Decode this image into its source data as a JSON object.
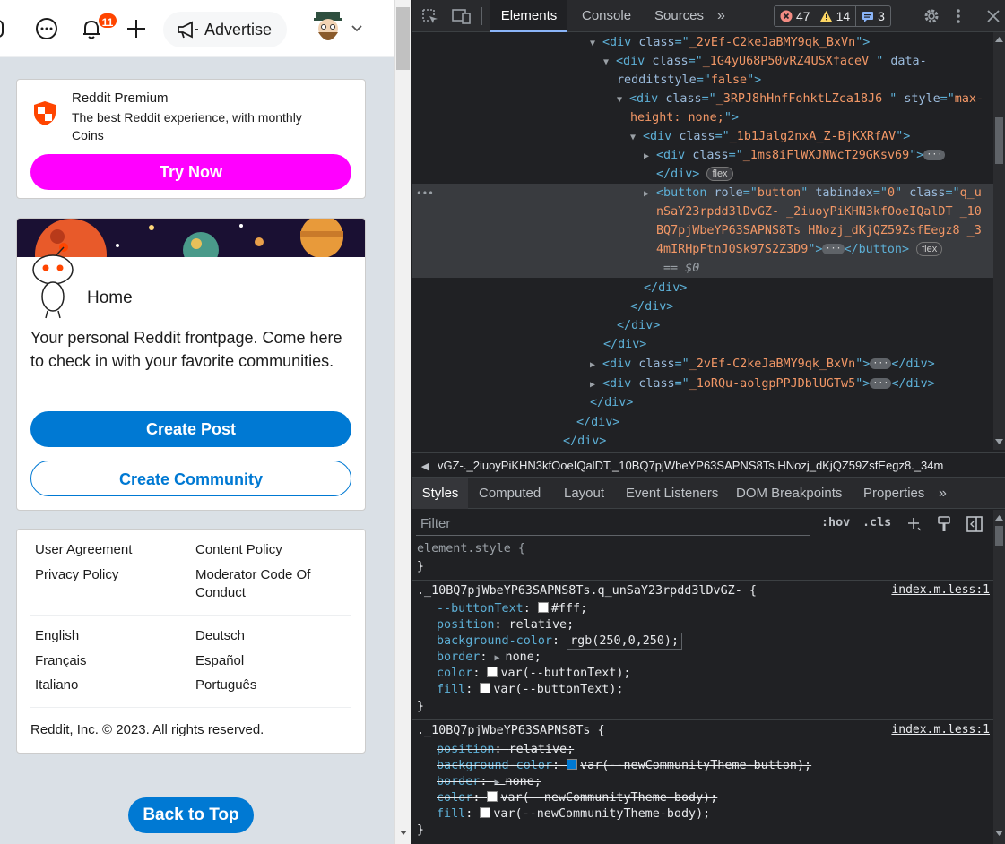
{
  "reddit": {
    "notification_count": "11",
    "advertise_label": "Advertise",
    "premium": {
      "title": "Reddit Premium",
      "desc_line1": "The best Reddit experience, with monthly",
      "desc_line2": "Coins",
      "button": "Try Now"
    },
    "home": {
      "title": "Home",
      "desc_line1": "Your personal Reddit frontpage. Come here",
      "desc_line2": "to check in with your favorite communities.",
      "create_post": "Create Post",
      "create_community": "Create Community"
    },
    "footer": {
      "links": [
        "User Agreement",
        "Content Policy",
        "Privacy Policy",
        "Moderator Code Of",
        "Conduct"
      ],
      "languages": [
        "English",
        "Deutsch",
        "Français",
        "Español",
        "Italiano",
        "Português"
      ],
      "copyright": "Reddit, Inc. © 2023. All rights reserved."
    },
    "back_to_top": "Back to Top"
  },
  "devtools": {
    "tabs": [
      "Elements",
      "Console",
      "Sources"
    ],
    "errors": "47",
    "warnings": "14",
    "messages": "3",
    "dom": {
      "l1": "_2vEf-C2keJaBMY9qk_BxVn",
      "l2a": "_1G4yU68P50vRZ4USXfaceV ",
      "l2b": "data-",
      "l2c": "redditstyle",
      "l2d": "false",
      "l3a": "_3RPJ8hHnfFohktLZca18J6 ",
      "l3b": "max-",
      "l3c": "height: none;",
      "l4": "_1b1Jalg2nxA_Z-BjKXRfAV",
      "l5": "_1ms8iFlWXJNWcT29GKsv69",
      "l7_role": "button",
      "l7_tabindex": "0",
      "l7_class_part": "q_u",
      "l8": "nSaY23rpdd3lDvGZ- _2iuoyPiKHN3kfOoeIQalDT _10",
      "l9": "BQ7pjWbeYP63SAPNS8Ts HNozj_dKjQZ59ZsfEegz8 _3",
      "l10": "4mIRHpFtnJ0Sk97S2Z3D9",
      "eq0": "== $0",
      "l16": "_2vEf-C2keJaBMY9qk_BxVn",
      "l17": "_1oRQu-aolgpPPJDblUGTw5",
      "flex": "flex"
    },
    "breadcrumb": "vGZ-._2iuoyPiKHN3kfOoeIQalDT._10BQ7pjWbeYP63SAPNS8Ts.HNozj_dKjQZ59ZsfEegz8._34m",
    "subtabs": [
      "Styles",
      "Computed",
      "Layout",
      "Event Listeners",
      "DOM Breakpoints",
      "Properties"
    ],
    "filter_placeholder": "Filter",
    "hov": ":hov",
    "cls": ".cls",
    "styles": {
      "element_style": "element.style {",
      "close": "}",
      "rule1_selector": "._10BQ7pjWbeYP63SAPNS8Ts.q_unSaY23rpdd3lDvGZ- {",
      "rule1_source": "index.m.less:1",
      "r1p1": "--buttonText",
      "r1v1": "#fff;",
      "r1p2": "position",
      "r1v2": "relative;",
      "r1p3": "background-color",
      "r1v3": "rgb(250,0,250);",
      "r1p4": "border",
      "r1v4": "none;",
      "r1p5": "color",
      "r1v5": "var(--buttonText);",
      "r1p6": "fill",
      "r1v6": "var(--buttonText);",
      "rule2_selector": "._10BQ7pjWbeYP63SAPNS8Ts {",
      "rule2_source": "index.m.less:1",
      "r2p1": "position",
      "r2v1": "relative;",
      "r2p2": "background-color",
      "r2v2": "var(--newCommunityTheme-button);",
      "r2p3": "border",
      "r2v3": "none;",
      "r2p4": "color",
      "r2v4": "var(--newCommunityTheme-body);",
      "r2p5": "fill",
      "r2v5": "var(--newCommunityTheme-body);"
    }
  },
  "colors": {
    "try_now": "#ff00ff",
    "reddit_blue": "#0079d3",
    "notification": "#ff4500"
  }
}
